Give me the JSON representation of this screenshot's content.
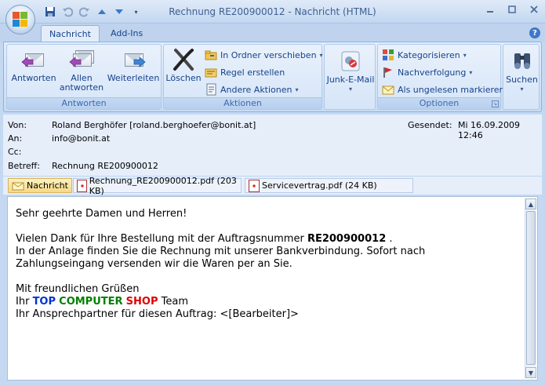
{
  "window": {
    "title": "Rechnung RE200900012 - Nachricht (HTML)"
  },
  "tabs": [
    {
      "label": "Nachricht"
    },
    {
      "label": "Add-Ins"
    }
  ],
  "ribbon": {
    "antworten": {
      "group_label": "Antworten",
      "reply": "Antworten",
      "reply_all_1": "Allen",
      "reply_all_2": "antworten",
      "forward": "Weiterleiten"
    },
    "aktionen": {
      "group_label": "Aktionen",
      "delete": "Löschen",
      "move_to_folder": "In Ordner verschieben",
      "create_rule": "Regel erstellen",
      "other_actions": "Andere Aktionen"
    },
    "junk": {
      "label": "Junk-E-Mail"
    },
    "optionen": {
      "group_label": "Optionen",
      "categorize": "Kategorisieren",
      "followup": "Nachverfolgung",
      "mark_unread": "Als ungelesen markieren"
    },
    "suchen": {
      "label": "Suchen"
    }
  },
  "header": {
    "from_label": "Von:",
    "from_value": "Roland Berghöfer [roland.berghoefer@bonit.at]",
    "to_label": "An:",
    "to_value": "info@bonit.at",
    "cc_label": "Cc:",
    "cc_value": "",
    "subject_label": "Betreff:",
    "subject_value": "Rechnung RE200900012",
    "sent_label": "Gesendet:",
    "sent_value": "Mi 16.09.2009 12:46"
  },
  "attachments": {
    "message_label": "Nachricht",
    "files": [
      {
        "name": "Rechnung_RE200900012.pdf (203 KB)"
      },
      {
        "name": "Servicevertrag.pdf (24 KB)"
      }
    ]
  },
  "body": {
    "greeting": "Sehr geehrte Damen und Herren!",
    "para1_pre": "Vielen Dank für Ihre Bestellung mit der Auftragsnummer ",
    "order_number": "RE200900012",
    "para1_post": " .",
    "para2": "In der Anlage finden Sie die Rechnung mit unserer Bankverbindung. Sofort nach Zahlungseingang versenden wir die Waren per  an Sie.",
    "closing": "Mit freundlichen Grüßen",
    "sig_prefix": "Ihr ",
    "sig_top": "TOP",
    "sig_computer": "COMPUTER",
    "sig_shop": "SHOP",
    "sig_suffix": " Team",
    "contact": "Ihr Ansprechpartner für diesen Auftrag: <[Bearbeiter]>"
  },
  "colors": {
    "top": "#0033cc",
    "computer": "#008000",
    "shop": "#e00000"
  }
}
